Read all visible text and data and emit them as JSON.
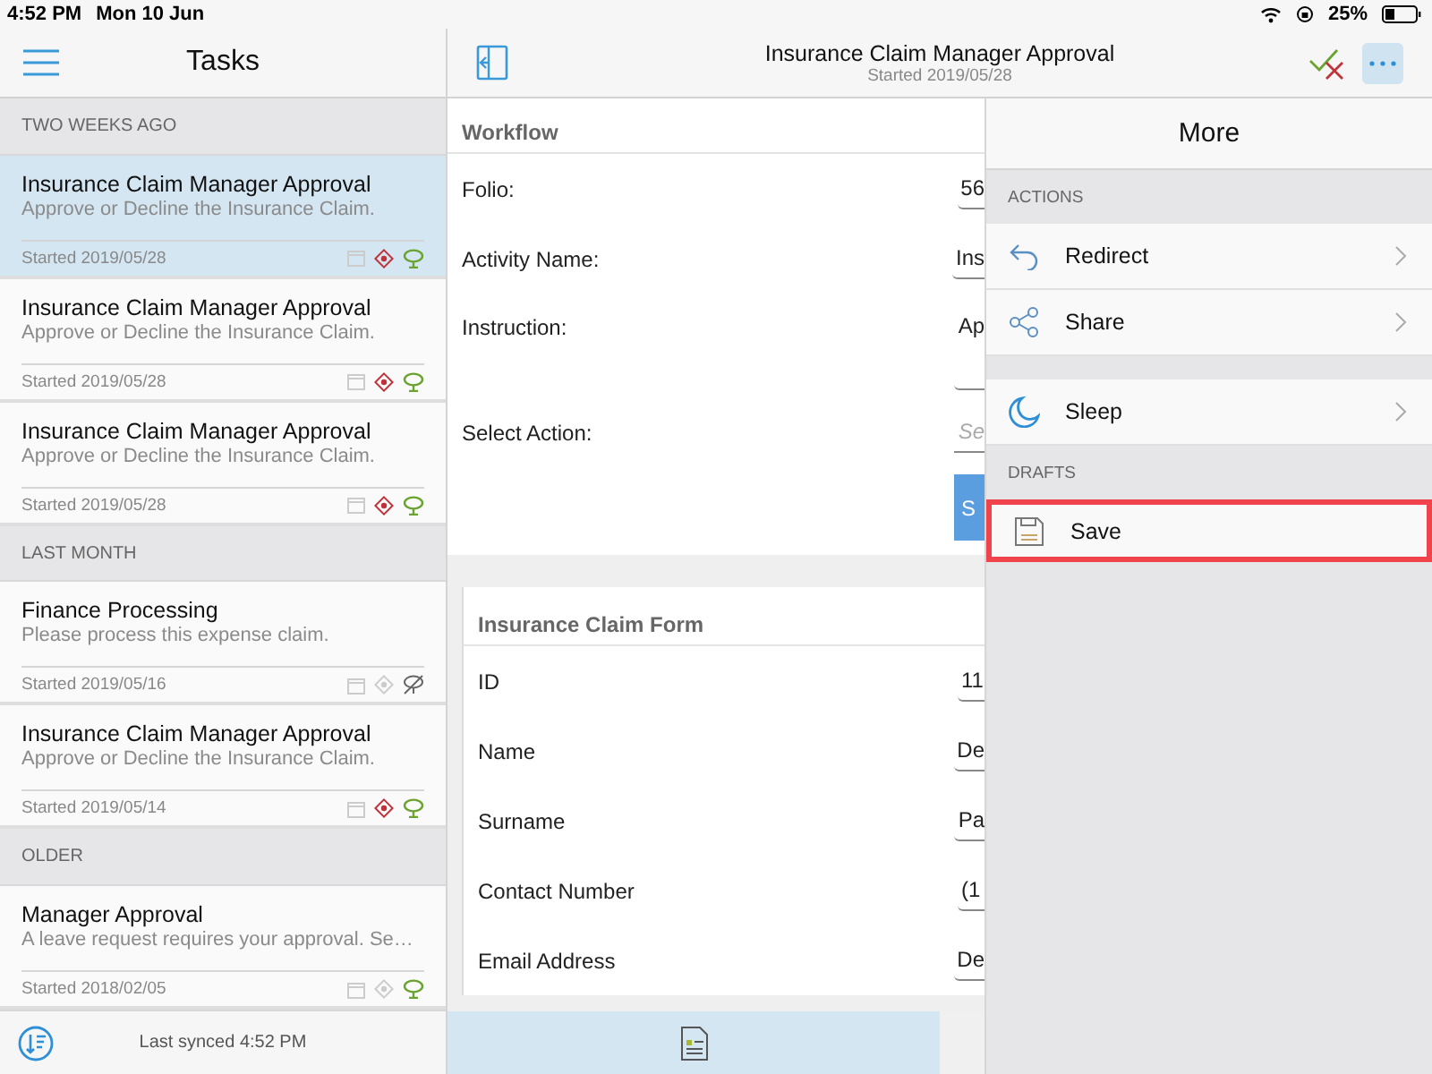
{
  "status_bar": {
    "time": "4:52 PM",
    "date": "Mon 10 Jun",
    "battery": "25%"
  },
  "task_list": {
    "title": "Tasks",
    "groups": [
      {
        "label": "TWO WEEKS AGO",
        "tasks": [
          {
            "title": "Insurance Claim Manager Approval",
            "subtitle": "Approve or Decline the Insurance Claim.",
            "started": "Started 2019/05/28",
            "selected": true,
            "priority": true,
            "status_ok": true
          },
          {
            "title": "Insurance Claim Manager Approval",
            "subtitle": "Approve or Decline the Insurance Claim.",
            "started": "Started 2019/05/28",
            "selected": false,
            "priority": true,
            "status_ok": true
          },
          {
            "title": "Insurance Claim Manager Approval",
            "subtitle": "Approve or Decline the Insurance Claim.",
            "started": "Started 2019/05/28",
            "selected": false,
            "priority": true,
            "status_ok": true
          }
        ]
      },
      {
        "label": "LAST MONTH",
        "tasks": [
          {
            "title": "Finance Processing",
            "subtitle": "Please process this expense claim.",
            "started": "Started 2019/05/16",
            "selected": false,
            "priority": false,
            "status_ok": false
          },
          {
            "title": "Insurance Claim Manager Approval",
            "subtitle": "Approve or Decline the Insurance Claim.",
            "started": "Started 2019/05/14",
            "selected": false,
            "priority": true,
            "status_ok": true
          }
        ]
      },
      {
        "label": "OLDER",
        "tasks": [
          {
            "title": "Manager Approval",
            "subtitle": "A leave request requires your approval. Se…",
            "started": "Started 2018/02/05",
            "selected": false,
            "priority": false,
            "status_ok": true
          }
        ]
      }
    ],
    "footer": "Last synced 4:52 PM"
  },
  "task_header": {
    "title": "Insurance Claim Manager Approval",
    "subtitle": "Started 2019/05/28"
  },
  "workflow": {
    "title": "Workflow",
    "fields": [
      {
        "label": "Folio:",
        "value": "56",
        "kind": "text"
      },
      {
        "label": "Activity Name:",
        "value": "Ins",
        "kind": "text"
      },
      {
        "label": "Instruction:",
        "value": "Ap",
        "kind": "multiline"
      },
      {
        "label": "Select Action:",
        "placeholder": "Se",
        "kind": "select"
      }
    ],
    "button": "S"
  },
  "claim_form": {
    "title": "Insurance Claim Form",
    "fields": [
      {
        "label": "ID",
        "value": "11"
      },
      {
        "label": "Name",
        "value": "De"
      },
      {
        "label": "Surname",
        "value": "Pa"
      },
      {
        "label": "Contact Number",
        "value": "(1"
      },
      {
        "label": "Email Address",
        "value": "De"
      }
    ]
  },
  "more_panel": {
    "title": "More",
    "sections": [
      {
        "label": "ACTIONS",
        "items": [
          {
            "label": "Redirect",
            "kind": "redirect",
            "chevron": true,
            "highlighted": false
          },
          {
            "label": "Share",
            "kind": "share",
            "chevron": true,
            "highlighted": false
          }
        ]
      },
      {
        "items": [
          {
            "label": "Sleep",
            "kind": "sleep",
            "chevron": true,
            "highlighted": false
          }
        ]
      },
      {
        "label": "DRAFTS",
        "items": [
          {
            "label": "Save",
            "kind": "save",
            "chevron": false,
            "highlighted": true
          }
        ]
      }
    ]
  }
}
